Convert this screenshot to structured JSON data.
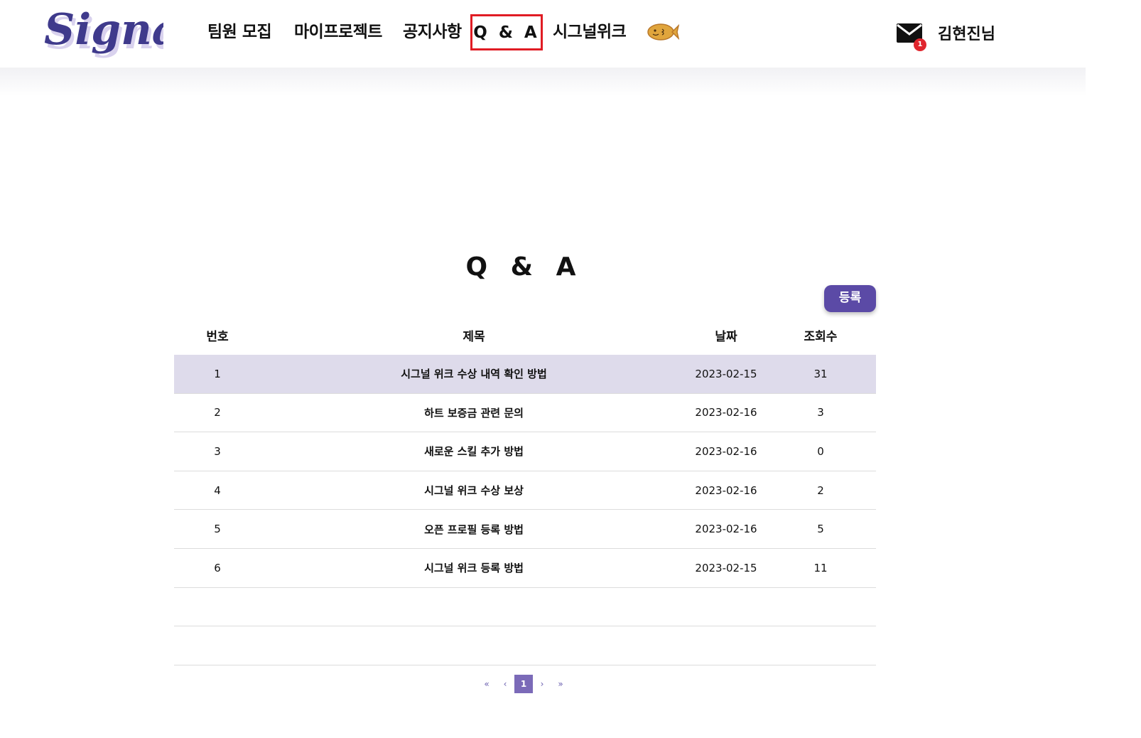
{
  "header": {
    "logo_text": "Signal",
    "nav": [
      {
        "label": "팀원 모집"
      },
      {
        "label": "마이프로젝트"
      },
      {
        "label": "공지사항"
      },
      {
        "label": "Q & A"
      },
      {
        "label": "시그널위크"
      }
    ],
    "mail_badge": "1",
    "username": "김현진님"
  },
  "main": {
    "title": "Q & A",
    "register_label": "등록",
    "columns": [
      "번호",
      "제목",
      "날짜",
      "조회수"
    ],
    "rows": [
      {
        "no": "1",
        "title": "시그널 위크 수상 내역 확인 방법",
        "date": "2023-02-15",
        "views": "31"
      },
      {
        "no": "2",
        "title": "하트 보증금 관련 문의",
        "date": "2023-02-16",
        "views": "3"
      },
      {
        "no": "3",
        "title": "새로운 스킬 추가 방법",
        "date": "2023-02-16",
        "views": "0"
      },
      {
        "no": "4",
        "title": "시그널 위크 수상 보상",
        "date": "2023-02-16",
        "views": "2"
      },
      {
        "no": "5",
        "title": "오픈 프로필 등록 방법",
        "date": "2023-02-16",
        "views": "5"
      },
      {
        "no": "6",
        "title": "시그널 위크 등록 방법",
        "date": "2023-02-15",
        "views": "11"
      }
    ]
  },
  "pagination": {
    "first": "«",
    "prev": "‹",
    "current": "1",
    "next": "›",
    "last": "»"
  },
  "colors": {
    "accent": "#5b4aa6",
    "selected_row": "#dedbeb",
    "active_nav_border": "#e01c24",
    "badge": "#e0262e"
  }
}
